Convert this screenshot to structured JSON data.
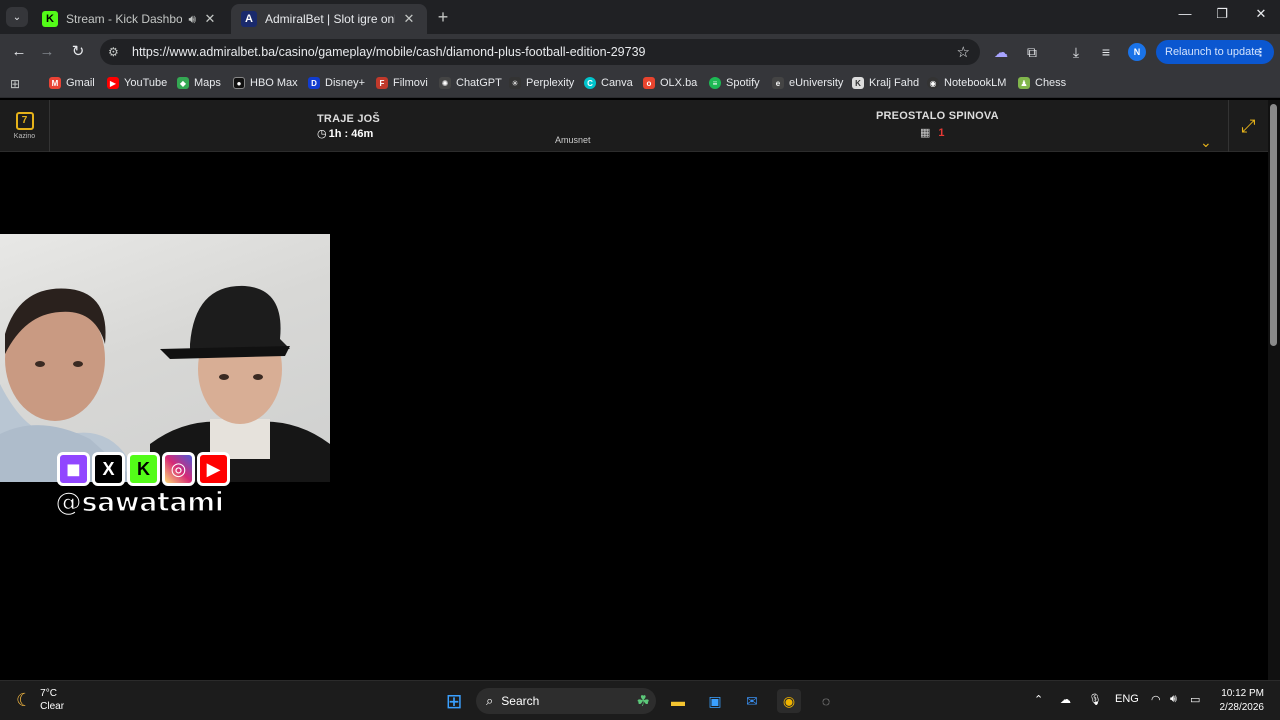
{
  "browser": {
    "tabs": [
      {
        "title": "Stream - Kick Dashboard",
        "favicon": "K",
        "favicon_color": "#53fc18",
        "active": false,
        "audio": true
      },
      {
        "title": "AdmiralBet | Slot igre online, ja",
        "favicon": "A",
        "favicon_color": "#1a2a6c",
        "active": true,
        "audio": false
      }
    ],
    "url": "https://www.admiralbet.ba/casino/gameplay/mobile/cash/diamond-plus-football-edition-29739",
    "profile_initial": "N",
    "relaunch_label": "Relaunch to update",
    "bookmarks": [
      {
        "label": "Gmail",
        "icon": "M",
        "color": "#ea4335"
      },
      {
        "label": "YouTube",
        "icon": "▶",
        "color": "#ff0000"
      },
      {
        "label": "Maps",
        "icon": "◆",
        "color": "#34a853"
      },
      {
        "label": "HBO Max",
        "icon": "●",
        "color": "#111111"
      },
      {
        "label": "Disney+",
        "icon": "D",
        "color": "#113ccf"
      },
      {
        "label": "Filmovi",
        "icon": "F",
        "color": "#c0392b"
      },
      {
        "label": "ChatGPT",
        "icon": "✺",
        "color": "#444444"
      },
      {
        "label": "Perplexity",
        "icon": "✳",
        "color": "#333333"
      },
      {
        "label": "Canva",
        "icon": "C",
        "color": "#00c4cc"
      },
      {
        "label": "OLX.ba",
        "icon": "o",
        "color": "#e8442e"
      },
      {
        "label": "Spotify",
        "icon": "≡",
        "color": "#1db954"
      },
      {
        "label": "eUniversity",
        "icon": "e",
        "color": "#444444"
      },
      {
        "label": "Kralj Fahd",
        "icon": "K",
        "color": "#dddddd"
      },
      {
        "label": "NotebookLM",
        "icon": "◉",
        "color": "#333333"
      },
      {
        "label": "Chess",
        "icon": "♟",
        "color": "#81b64c"
      }
    ]
  },
  "game": {
    "kazino_label": "Kazino",
    "time_left_label": "TRAJE JOŠ",
    "time_left_value": "1h : 46m",
    "provider": "Amusnet",
    "spins_left_label": "PREOSTALO SPINOVA",
    "spins_left_value": "1"
  },
  "overlay": {
    "handle": "@sawatami"
  },
  "taskbar": {
    "temperature": "7°C",
    "weather": "Clear",
    "search_label": "Search",
    "language": "ENG",
    "time": "10:12 PM",
    "date": "2/28/2026"
  }
}
